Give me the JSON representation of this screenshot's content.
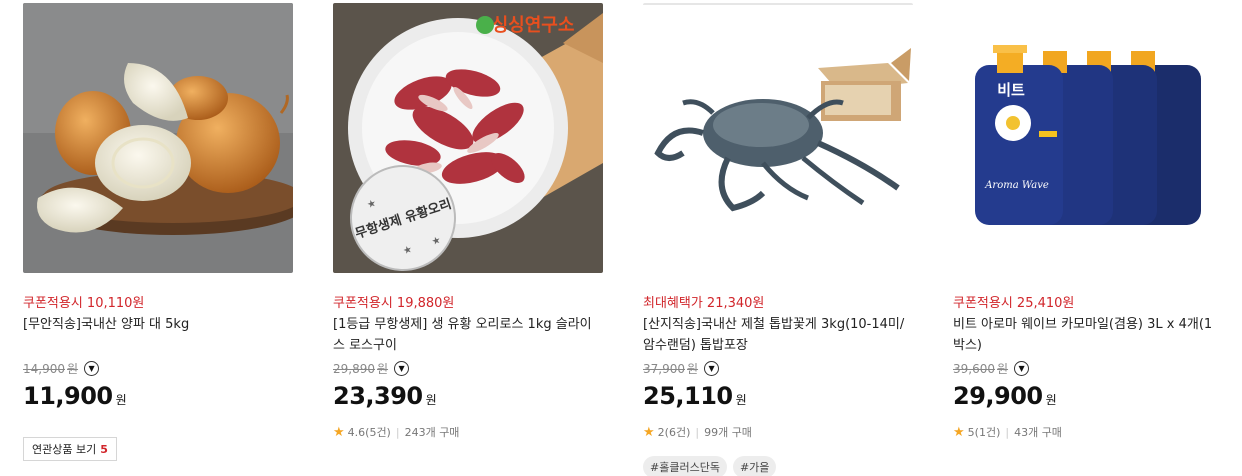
{
  "products": [
    {
      "image": "onion-photo",
      "promo": "쿠폰적용시 10,110원",
      "title": "[무안직송]국내산 양파 대 5kg",
      "original_price": "14,900",
      "original_won": "원",
      "price": "11,900",
      "won": "원",
      "related_label": "연관상품 보기",
      "related_count": "5"
    },
    {
      "image": "raw-duck-meat-photo",
      "logo_text": "싱싱연구소",
      "stamp_text": "무항생제 유황오리",
      "promo": "쿠폰적용시 19,880원",
      "title": "[1등급 무항생제] 생 유황 오리로스 1kg 슬라이스 로스구이",
      "original_price": "29,890",
      "original_won": "원",
      "price": "23,390",
      "won": "원",
      "rating": "4.6(5건)",
      "purchases": "243개 구매"
    },
    {
      "image": "blue-crab-photo",
      "promo": "최대혜택가 21,340원",
      "title": "[산지직송]국내산 제철 톱밥꽃게 3kg(10-14미/암수랜덤) 톱밥포장",
      "original_price": "37,900",
      "original_won": "원",
      "price": "25,110",
      "won": "원",
      "rating": "2(6건)",
      "purchases": "99개 구매",
      "tags": [
        "#홀클러스단독",
        "#가을"
      ]
    },
    {
      "image": "detergent-bottles-photo",
      "bottle_brand": "비트",
      "bottle_line": "Aroma Wave",
      "promo": "쿠폰적용시 25,410원",
      "title": "비트 아로마 웨이브 카모마일(겸용) 3L x 4개(1박스)",
      "original_price": "39,600",
      "original_won": "원",
      "price": "29,900",
      "won": "원",
      "rating": "5(1건)",
      "purchases": "43개 구매"
    }
  ],
  "colors": {
    "promo": "#d1262b",
    "star": "#f5a623",
    "price": "#111111"
  },
  "icons": {
    "expand": "chevron-down-icon",
    "rating": "star-icon"
  }
}
